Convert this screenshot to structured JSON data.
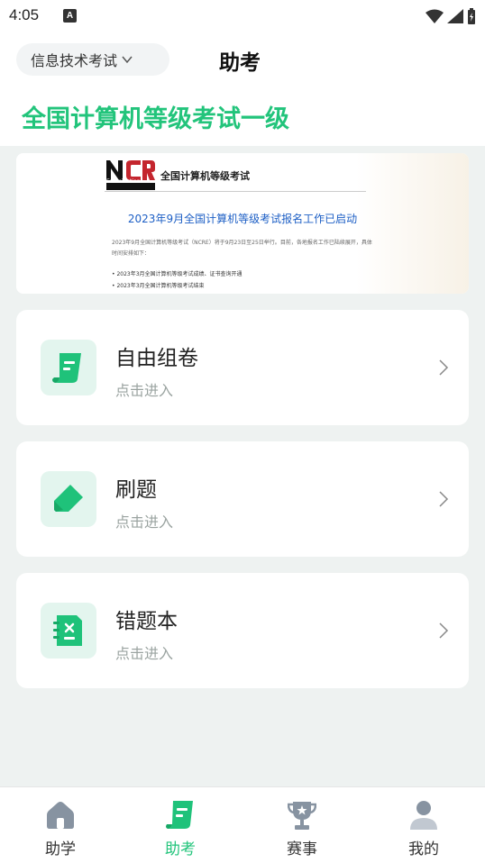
{
  "status_bar": {
    "time": "4:05",
    "notification_glyph": "A"
  },
  "header": {
    "exam_selector": "信息技术考试",
    "page_title": "助考",
    "subject_title": "全国计算机等级考试一级"
  },
  "banner": {
    "logo_caption": "Examination",
    "brand_name": "全国计算机等级考试",
    "headline": "2023年9月全国计算机等级考试报名工作已启动",
    "body": "2023年9月全国计算机等级考试（NCRE）将于9月23日至25日举行。目前，各地报名工作已陆续展开，具体时间安排如下：",
    "bullets": [
      "• 2023年3月全国计算机等级考试成绩、证书查询开通",
      "• 2023年3月全国计算机等级考试结束"
    ]
  },
  "cards": [
    {
      "title": "自由组卷",
      "subtitle": "点击进入",
      "icon": "scroll-icon"
    },
    {
      "title": "刷题",
      "subtitle": "点击进入",
      "icon": "eraser-icon"
    },
    {
      "title": "错题本",
      "subtitle": "点击进入",
      "icon": "wrong-notebook-icon"
    }
  ],
  "bottom_nav": [
    {
      "label": "助学",
      "icon": "home-icon",
      "active": false
    },
    {
      "label": "助考",
      "icon": "scroll-icon",
      "active": true
    },
    {
      "label": "赛事",
      "icon": "trophy-icon",
      "active": false
    },
    {
      "label": "我的",
      "icon": "person-icon",
      "active": false
    }
  ],
  "colors": {
    "accent": "#22c47b",
    "icon_bg": "#e3f5ee",
    "page_bg": "#eef2f1",
    "headline_blue": "#1d5fc5"
  }
}
